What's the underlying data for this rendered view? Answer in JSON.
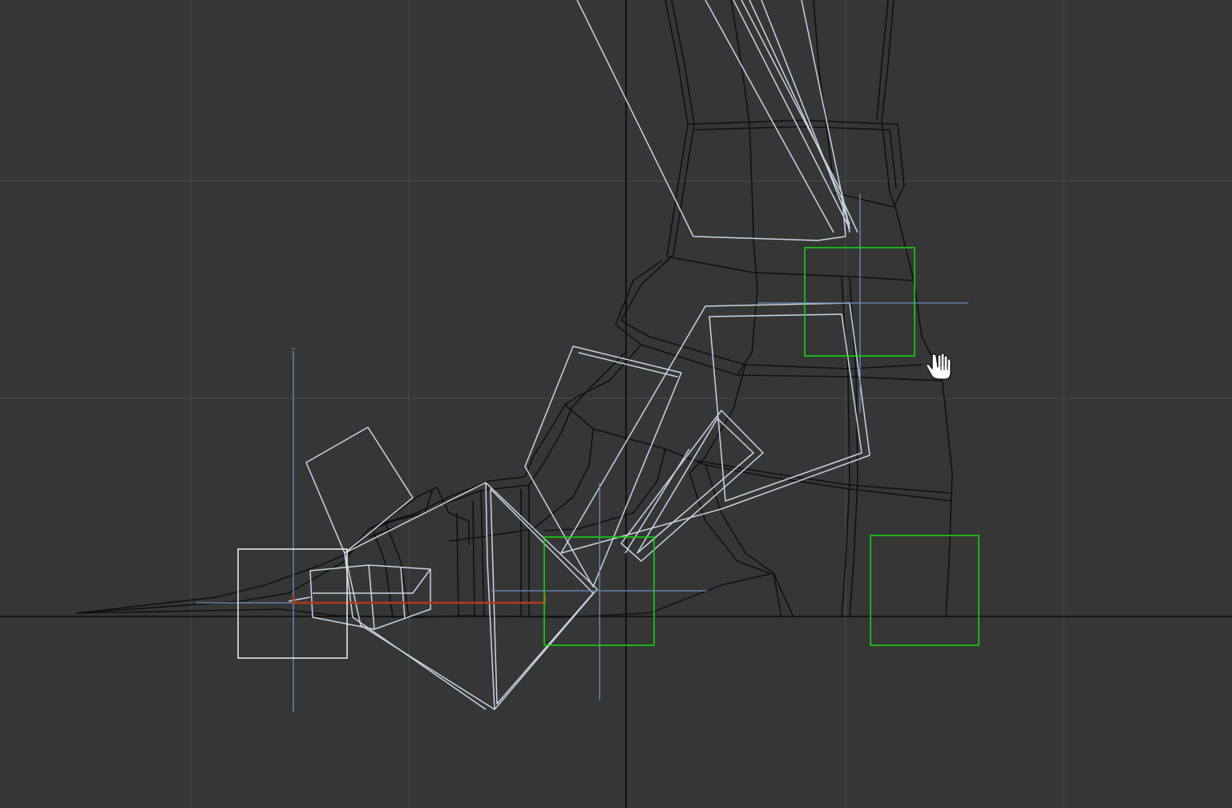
{
  "viewport": {
    "name": "3d-viewport",
    "background": "#363636",
    "grid_color": "#4b4b4b",
    "mesh_color": "#111111",
    "bone_color": "#c9d4e2",
    "control_color_selected": "#14d214",
    "control_color_default": "#e6e6e6",
    "gizmo_color": "#6b8fbf",
    "ik_chain_color": "#b23a1e",
    "axis_label": "z",
    "cursor_icon": "hand-pan-icon"
  }
}
